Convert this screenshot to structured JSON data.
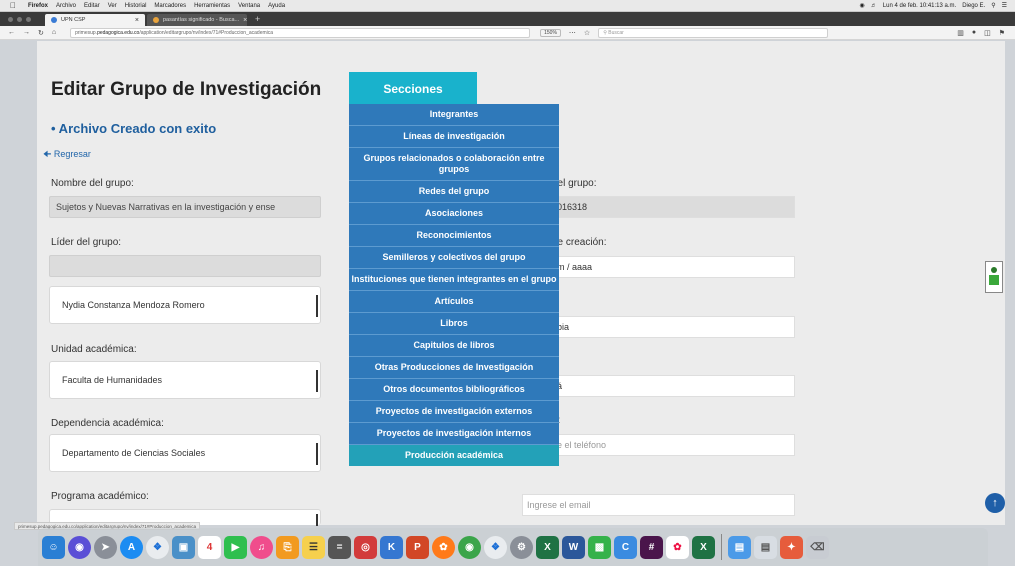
{
  "menubar": {
    "app_name": "Firefox",
    "items": [
      "Archivo",
      "Editar",
      "Ver",
      "Historial",
      "Marcadores",
      "Herramientas",
      "Ventana",
      "Ayuda"
    ],
    "clock": "Lun 4 de feb. 10:41:13 a.m.",
    "user": "Diego E."
  },
  "tabs": [
    {
      "label": "UPN CSP",
      "active": true
    },
    {
      "label": "pasantías significado - Busca...",
      "active": false
    }
  ],
  "navbar": {
    "url_prefix": "primesup.",
    "url_domain": "pedagogica.edu.co",
    "url_rest": "/application/editargrupo/nv/index/71#Produccion_academica",
    "zoom": "150%",
    "search_placeholder": "Buscar"
  },
  "page": {
    "title": "Editar Grupo de Investigación",
    "success_message": "• Archivo Creado con exito",
    "back_link": "Regresar",
    "fields": {
      "nombre_label": "Nombre del grupo:",
      "nombre_value": "Sujetos y Nuevas Narrativas en la investigación y ense",
      "lider_label": "Líder del grupo:",
      "lider_select": "Nydia Constanza Mendoza Romero",
      "unidad_label": "Unidad académica:",
      "unidad_select": "Faculta de Humanidades",
      "dependencia_label": "Dependencia académica:",
      "dependencia_select": "Departamento de Ciencias Sociales",
      "programa_label": "Programa académico:"
    },
    "right": {
      "codigo_label": "del grupo:",
      "codigo_value": "016318",
      "fecha_label": "de creación:",
      "fecha_value": "m / aaaa",
      "pais_value": "bia",
      "colon1": ":",
      "ciudad_value": "á",
      "tel_label": "o:",
      "tel_placeholder": "e el teléfono",
      "email_placeholder": "Ingrese el email"
    },
    "status_url": "primesup.pedagogica.edu.co/application/editargrupo/nv/index/71#Produccion_academica"
  },
  "secciones": {
    "button_label": "Secciones",
    "items": [
      "Integrantes",
      "Líneas de investigación",
      "Grupos relacionados o colaboración entre grupos",
      "Redes del grupo",
      "Asociaciones",
      "Reconocimientos",
      "Semilleros y colectivos del grupo",
      "Instituciones que tienen integrantes en el grupo",
      "Artículos",
      "Libros",
      "Capitulos de libros",
      "Otras Producciones de Investigación",
      "Otros documentos bibliográficos",
      "Proyectos de investigación externos",
      "Proyectos de investigación internos",
      "Producción académica"
    ]
  },
  "dock_apps": [
    "finder",
    "siri",
    "launchpad",
    "app-store",
    "safari",
    "preview",
    "calendar",
    "facetime",
    "itunes",
    "ibooks",
    "notes",
    "calculator",
    "photo-booth",
    "keynote",
    "powerpoint",
    "firefox",
    "chrome",
    "safari-2",
    "settings",
    "excel",
    "word",
    "numbers",
    "creative-cloud",
    "slack",
    "photos",
    "excel-2",
    "folder",
    "files",
    "launcher",
    "trash"
  ]
}
